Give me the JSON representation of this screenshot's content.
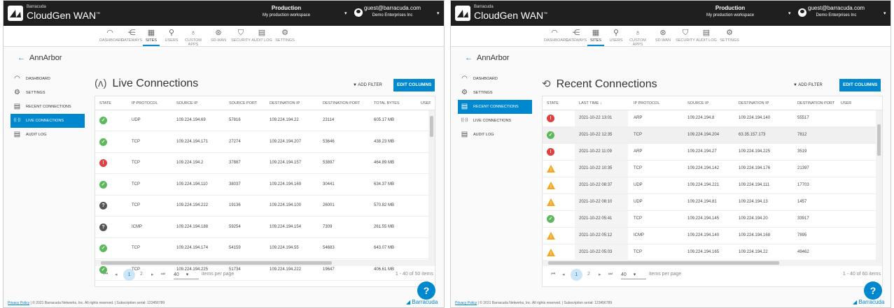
{
  "app": {
    "brand_small": "Barracuda",
    "brand": "CloudGen WAN",
    "trademark": "™"
  },
  "header": {
    "workspace_name": "Production",
    "workspace_sub": "My production workspace",
    "user_email": "guest@barracuda.com",
    "user_org": "Demo Enterprises Inc"
  },
  "nav": [
    {
      "label": "DASHBOARD",
      "icon": "speedometer-icon",
      "glyph": "◠"
    },
    {
      "label": "GATEWAYS",
      "icon": "gateway-icon",
      "glyph": "⋲"
    },
    {
      "label": "SITES",
      "icon": "sites-icon",
      "glyph": "▦"
    },
    {
      "label": "USERS",
      "icon": "users-icon",
      "glyph": "⚲"
    },
    {
      "label": "CUSTOM APPS",
      "icon": "custom-apps-icon",
      "glyph": "♁"
    },
    {
      "label": "SD-WAN",
      "icon": "sdwan-icon",
      "glyph": "⊛"
    },
    {
      "label": "SECURITY",
      "icon": "shield-icon",
      "glyph": "⛉"
    },
    {
      "label": "AUDIT LOG",
      "icon": "audit-log-icon",
      "glyph": "▤"
    },
    {
      "label": "SETTINGS",
      "icon": "gear-icon",
      "glyph": "⚙"
    }
  ],
  "breadcrumb": {
    "back_glyph": "←",
    "site": "AnnArbor"
  },
  "sidebar": [
    {
      "label": "DASHBOARD",
      "icon": "speedometer-icon",
      "glyph": "◠"
    },
    {
      "label": "SETTINGS",
      "icon": "gear-icon",
      "glyph": "⚙"
    },
    {
      "label": "RECENT CONNECTIONS",
      "icon": "document-icon",
      "glyph": "▤"
    },
    {
      "label": "LIVE CONNECTIONS",
      "icon": "antenna-icon",
      "glyph": "((·))"
    },
    {
      "label": "AUDIT LOG",
      "icon": "document-icon",
      "glyph": "▤"
    }
  ],
  "live": {
    "title": "Live Connections",
    "add_filter": "ADD FILTER",
    "edit_columns": "EDIT COLUMNS",
    "columns": [
      "STATE",
      "IP PROTOCOL",
      "SOURCE IP",
      "SOURCE PORT",
      "DESTINATION IP",
      "DESTINATION PORT",
      "TOTAL BYTES",
      "USEF"
    ],
    "rows": [
      {
        "state": "ok",
        "proto": "UDP",
        "src": "109.224.194.69",
        "sport": "57816",
        "dst": "109.224.194.22",
        "dport": "23114",
        "bytes": "605.17 MB"
      },
      {
        "state": "ok",
        "proto": "TCP",
        "src": "109.224.194.171",
        "sport": "27274",
        "dst": "109.224.194.207",
        "dport": "53646",
        "bytes": "438.23 MB"
      },
      {
        "state": "err",
        "proto": "TCP",
        "src": "109.224.194.2",
        "sport": "37887",
        "dst": "109.224.194.157",
        "dport": "53897",
        "bytes": "464.89 MB"
      },
      {
        "state": "ok",
        "proto": "TCP",
        "src": "109.224.194.110",
        "sport": "38037",
        "dst": "109.224.194.169",
        "dport": "30441",
        "bytes": "634.37 MB"
      },
      {
        "state": "unk",
        "proto": "TCP",
        "src": "109.224.194.222",
        "sport": "19136",
        "dst": "109.224.194.100",
        "dport": "26001",
        "bytes": "570.82 MB"
      },
      {
        "state": "unk",
        "proto": "ICMP",
        "src": "109.224.194.188",
        "sport": "59254",
        "dst": "109.224.194.154",
        "dport": "7309",
        "bytes": "261.55 MB"
      },
      {
        "state": "ok",
        "proto": "TCP",
        "src": "109.224.194.174",
        "sport": "54159",
        "dst": "109.224.194.55",
        "dport": "54683",
        "bytes": "643.07 MB"
      },
      {
        "state": "ok",
        "proto": "TCP",
        "src": "109.224.194.225",
        "sport": "51734",
        "dst": "109.224.194.222",
        "dport": "19647",
        "bytes": "406.61 MB"
      }
    ],
    "pager": {
      "pages": [
        "1",
        "2"
      ],
      "page_size": "40",
      "per_page_label": "items per page",
      "total": "1 - 40 of 50 items"
    }
  },
  "recent": {
    "title": "Recent Connections",
    "add_filter": "ADD FILTER",
    "edit_columns": "EDIT COLUMNS",
    "columns": [
      "STATE",
      "LAST TIME ↓",
      "IP PROTOCOL",
      "SOURCE IP",
      "DESTINATION IP",
      "DESTINATION PORT",
      "USER"
    ],
    "rows": [
      {
        "state": "err",
        "time": "2021-10-22 13:01",
        "proto": "ARP",
        "src": "109.224.194.8",
        "dst": "109.224.194.140",
        "dport": "55517"
      },
      {
        "state": "ok",
        "time": "2021-10-22 12:35",
        "proto": "TCP",
        "src": "109.224.194.204",
        "dst": "63.35.157.173",
        "dport": "7812"
      },
      {
        "state": "err",
        "time": "2021-10-22 11:09",
        "proto": "ARP",
        "src": "109.224.194.27",
        "dst": "109.224.194.225",
        "dport": "3519"
      },
      {
        "state": "warn",
        "time": "2021-10-22 10:35",
        "proto": "TCP",
        "src": "109.224.194.142",
        "dst": "109.224.194.176",
        "dport": "21397"
      },
      {
        "state": "warn",
        "time": "2021-10-22 08:37",
        "proto": "UDP",
        "src": "109.224.194.221",
        "dst": "109.224.194.111",
        "dport": "17703"
      },
      {
        "state": "warn",
        "time": "2021-10-22 08:10",
        "proto": "UDP",
        "src": "109.224.194.81",
        "dst": "109.224.194.13",
        "dport": "1457"
      },
      {
        "state": "ok",
        "time": "2021-10-22 05:41",
        "proto": "TCP",
        "src": "109.224.194.145",
        "dst": "109.224.194.20",
        "dport": "33917"
      },
      {
        "state": "warn",
        "time": "2021-10-22 05:12",
        "proto": "ICMP",
        "src": "109.224.194.140",
        "dst": "109.224.194.168",
        "dport": "7895"
      },
      {
        "state": "warn",
        "time": "2021-10-22 05:03",
        "proto": "TCP",
        "src": "109.224.194.165",
        "dst": "109.224.194.22",
        "dport": "49462"
      }
    ],
    "pager": {
      "pages": [
        "1",
        "2"
      ],
      "page_size": "40",
      "per_page_label": "items per page",
      "total": "1 - 40 of 60 items"
    }
  },
  "footer": {
    "privacy": "Privacy Policy",
    "text": " | © 2021 Barracuda Networks, Inc. All rights reserved. | Subscription serial: 123456789",
    "logo_text": "Barracuda",
    "help_glyph": "?"
  },
  "state_glyphs": {
    "ok": "✓",
    "err": "!",
    "unk": "?",
    "warn": "!"
  },
  "colors": {
    "accent": "#0088ce",
    "topbar": "#1f1f1f",
    "ok": "#5cb85c",
    "error": "#e04040",
    "warning": "#f5a623"
  }
}
